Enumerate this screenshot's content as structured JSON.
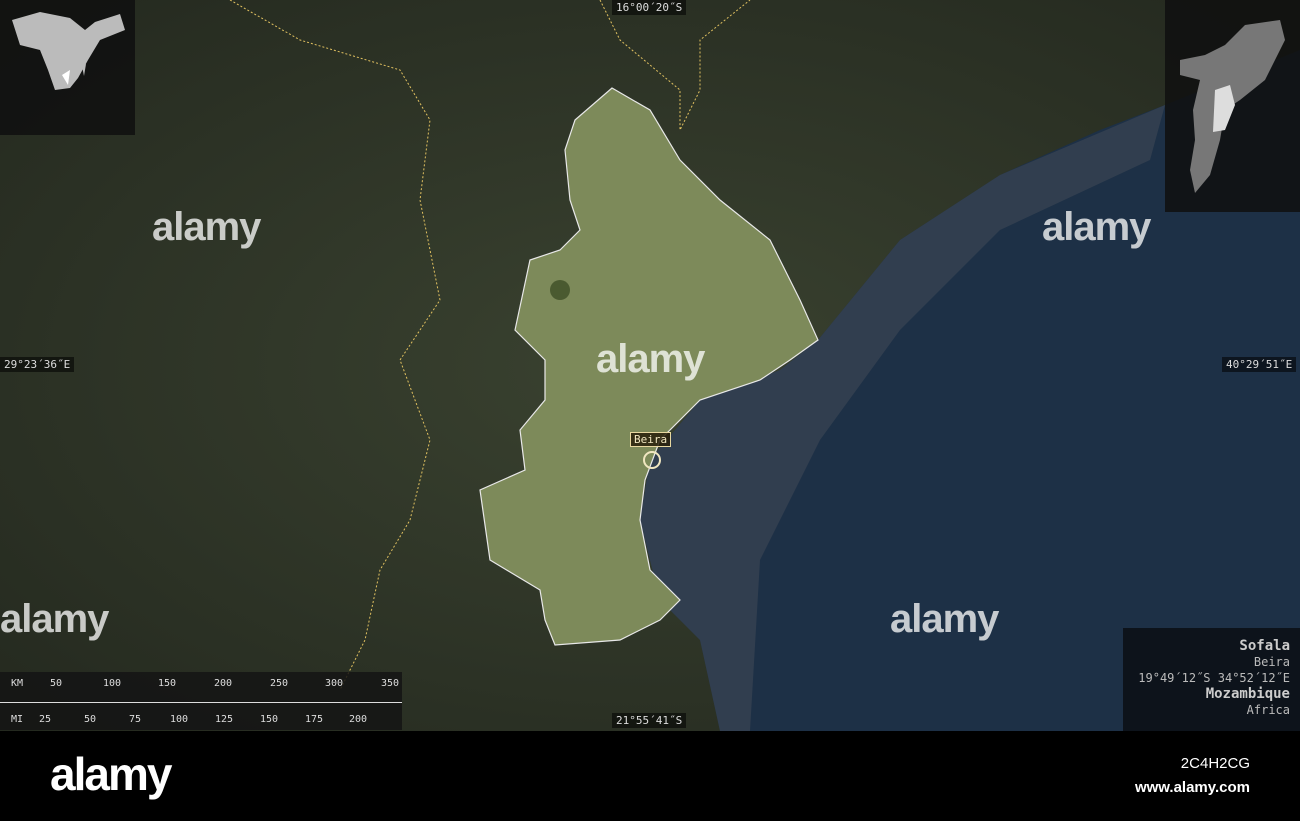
{
  "map": {
    "coords": {
      "top": "16°00´20˝S",
      "bottom": "21°55´41˝S",
      "left": "29°23´36˝E",
      "right": "40°29´51˝E"
    },
    "city_label": "Beira",
    "watermark": "alamy",
    "colors": {
      "land": "#2e3428",
      "region": "#7d8a5a",
      "ocean": "#1d3046",
      "border": "#e0c060"
    }
  },
  "scale": {
    "km_label": "KM",
    "mi_label": "MI",
    "km_ticks": [
      "50",
      "100",
      "150",
      "200",
      "250",
      "300",
      "350"
    ],
    "mi_ticks": [
      "25",
      "50",
      "75",
      "100",
      "125",
      "150",
      "175",
      "200"
    ]
  },
  "info": {
    "region": "Sofala",
    "capital": "Beira",
    "coordinates": "19°49´12˝S 34°52´12˝E",
    "country": "Mozambique",
    "continent": "Africa"
  },
  "footer": {
    "logo": "alamy",
    "image_id": "2C4H2CG",
    "url": "www.alamy.com"
  }
}
